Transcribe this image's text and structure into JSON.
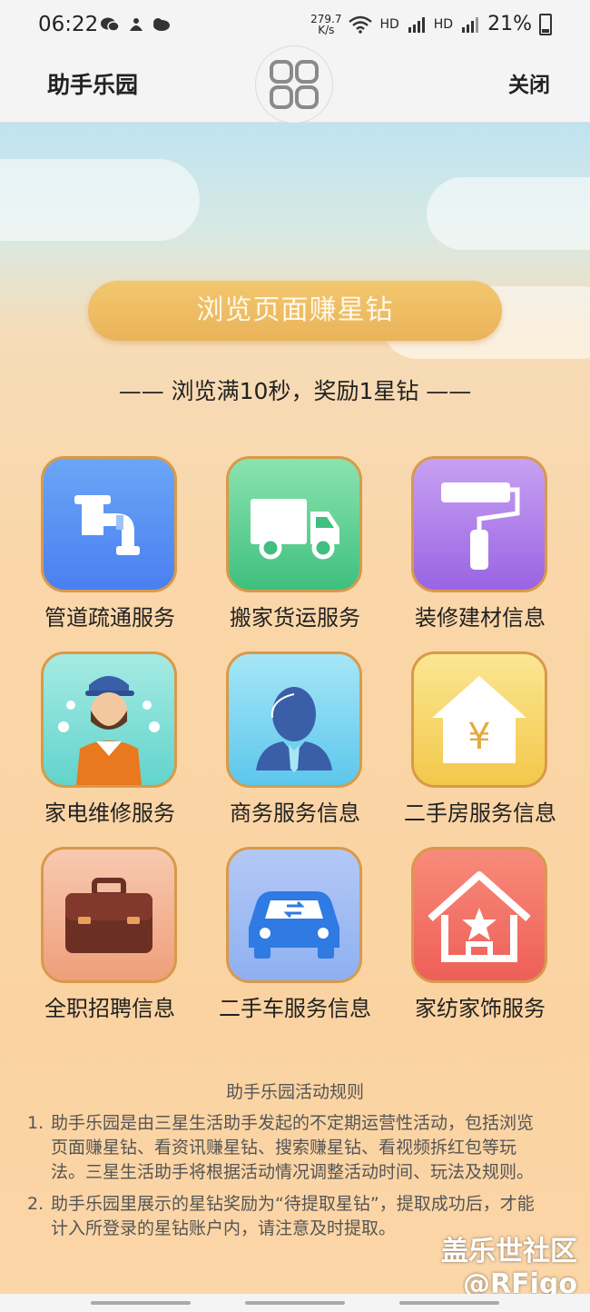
{
  "status_bar": {
    "time": "06:22",
    "speed": "279.7\nK/s",
    "network1": "HD",
    "network2": "HD",
    "battery": "21%"
  },
  "header": {
    "title": "助手乐园",
    "close_label": "关闭"
  },
  "banner": {
    "label": "浏览页面赚星钻"
  },
  "subtitle": "—— 浏览满10秒，奖励1星钻 ——",
  "services": [
    {
      "label": "管道疏通服务",
      "icon": "pipe-icon",
      "color_top": "#6aa6f7",
      "color_bottom": "#4b7ff0"
    },
    {
      "label": "搬家货运服务",
      "icon": "truck-icon",
      "color_top": "#8be3b0",
      "color_bottom": "#3fc07e"
    },
    {
      "label": "装修建材信息",
      "icon": "paint-roller-icon",
      "color_top": "#c7a1f2",
      "color_bottom": "#9a64e3"
    },
    {
      "label": "家电维修服务",
      "icon": "repairman-icon",
      "color_top": "#a6ebe3",
      "color_bottom": "#62d4cc"
    },
    {
      "label": "商务服务信息",
      "icon": "business-person-icon",
      "color_top": "#a6e6f7",
      "color_bottom": "#5cc7ec"
    },
    {
      "label": "二手房服务信息",
      "icon": "house-yen-icon",
      "color_top": "#fbe693",
      "color_bottom": "#f3c84a"
    },
    {
      "label": "全职招聘信息",
      "icon": "briefcase-icon",
      "color_top": "#f8c9b0",
      "color_bottom": "#ee9f7a"
    },
    {
      "label": "二手车服务信息",
      "icon": "car-icon",
      "color_top": "#b4c8f5",
      "color_bottom": "#8eb0f1"
    },
    {
      "label": "家纺家饰服务",
      "icon": "home-star-icon",
      "color_top": "#f88b7a",
      "color_bottom": "#ee5f58"
    }
  ],
  "rules": {
    "title": "助手乐园活动规则",
    "items": [
      {
        "num": "1.",
        "text": "助手乐园是由三星生活助手发起的不定期运营性活动，包括浏览页面赚星钻、看资讯赚星钻、搜索赚星钻、看视频拆红包等玩法。三星生活助手将根据活动情况调整活动时间、玩法及规则。"
      },
      {
        "num": "2.",
        "text": "助手乐园里展示的星钻奖励为“待提取星钻”，提取成功后，才能计入所登录的星钻账户内，请注意及时提取。"
      }
    ]
  },
  "watermark": {
    "line1": "盖乐世社区",
    "line2": "@RFigo"
  }
}
